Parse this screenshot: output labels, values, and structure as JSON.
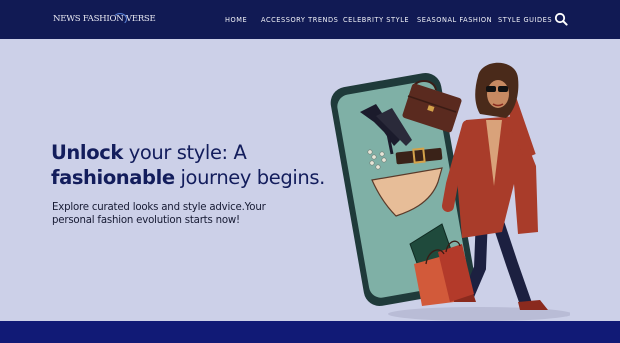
{
  "site": {
    "logo_text": "NEWS FASHION VERSE",
    "logo_icon": "swirl-logo-icon"
  },
  "nav": {
    "items": [
      {
        "label": "HOME"
      },
      {
        "label": "ACCESSORY TRENDS"
      },
      {
        "label": "CELEBRITY STYLE"
      },
      {
        "label": "SEASONAL FASHION"
      },
      {
        "label": "STYLE GUIDES"
      }
    ],
    "search_icon": "search-icon"
  },
  "hero": {
    "title_bold_1": "Unlock",
    "title_rest_1": " your style: A",
    "title_bold_2": "fashionable",
    "title_rest_2": " journey begins.",
    "subtitle": "Explore curated looks and style advice.Your personal fashion evolution starts now!",
    "illustration": "woman-with-shopping-bags-and-phone-illustration"
  },
  "colors": {
    "header_bg": "#111a54",
    "page_bg": "#ccd0e8",
    "title": "#131d5c",
    "footer_band": "#111a76"
  }
}
